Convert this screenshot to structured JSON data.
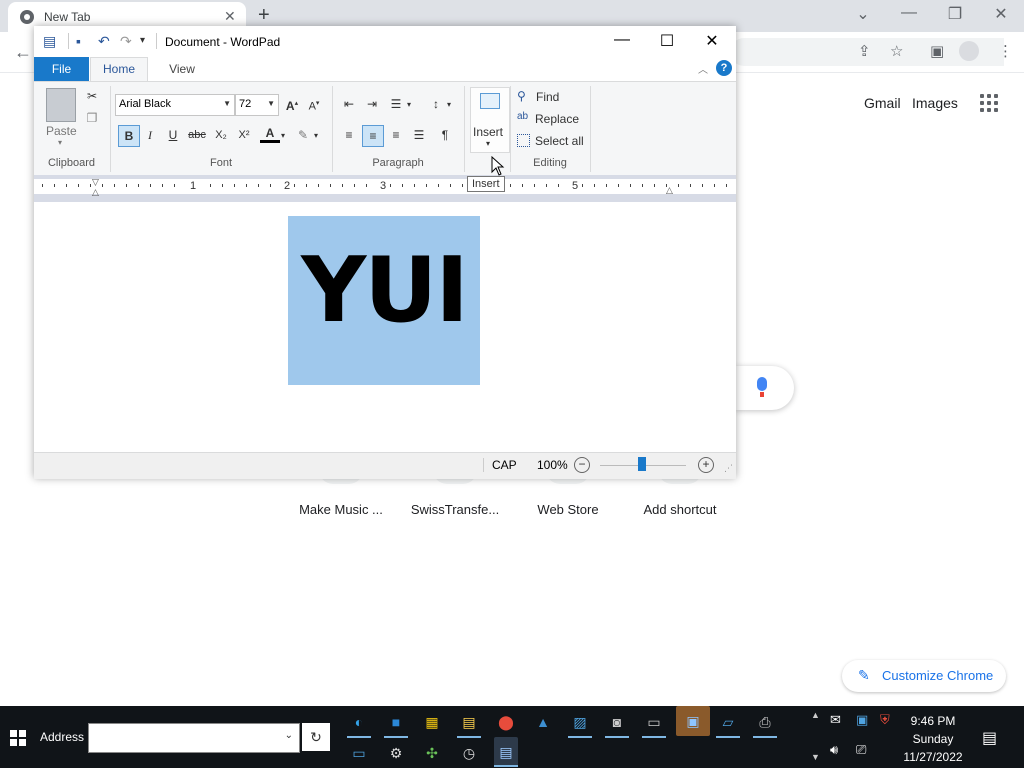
{
  "chrome": {
    "tab_title": "New Tab",
    "new_tab_symbol": "+",
    "close_symbol": "✕",
    "links": {
      "gmail": "Gmail",
      "images": "Images"
    },
    "shortcuts": [
      "Make Music ...",
      "SwissTransfe...",
      "Web Store",
      "Add shortcut"
    ],
    "customize_label": "Customize Chrome",
    "accent": "#1a73e8"
  },
  "wordpad": {
    "title": "Document - WordPad",
    "tabs": [
      "File",
      "Home",
      "View"
    ],
    "help_symbol": "?",
    "clipboard": {
      "paste": "Paste",
      "group": "Clipboard"
    },
    "font": {
      "name": "Arial Black",
      "size": "72",
      "group": "Font"
    },
    "paragraph": {
      "group": "Paragraph"
    },
    "insert": {
      "label": "Insert"
    },
    "editing": {
      "find": "Find",
      "replace": "Replace",
      "select_all": "Select all",
      "group": "Editing"
    },
    "ruler_numbers": [
      "1",
      "2",
      "3",
      "5"
    ],
    "document_text": "YUI",
    "status": {
      "cap": "CAP",
      "zoom": "100%"
    },
    "tooltip": "Insert",
    "selection_color": "#9fc8ec"
  },
  "taskbar": {
    "address_label": "Address",
    "time": "9:46 PM",
    "day": "Sunday",
    "date": "11/27/2022"
  }
}
